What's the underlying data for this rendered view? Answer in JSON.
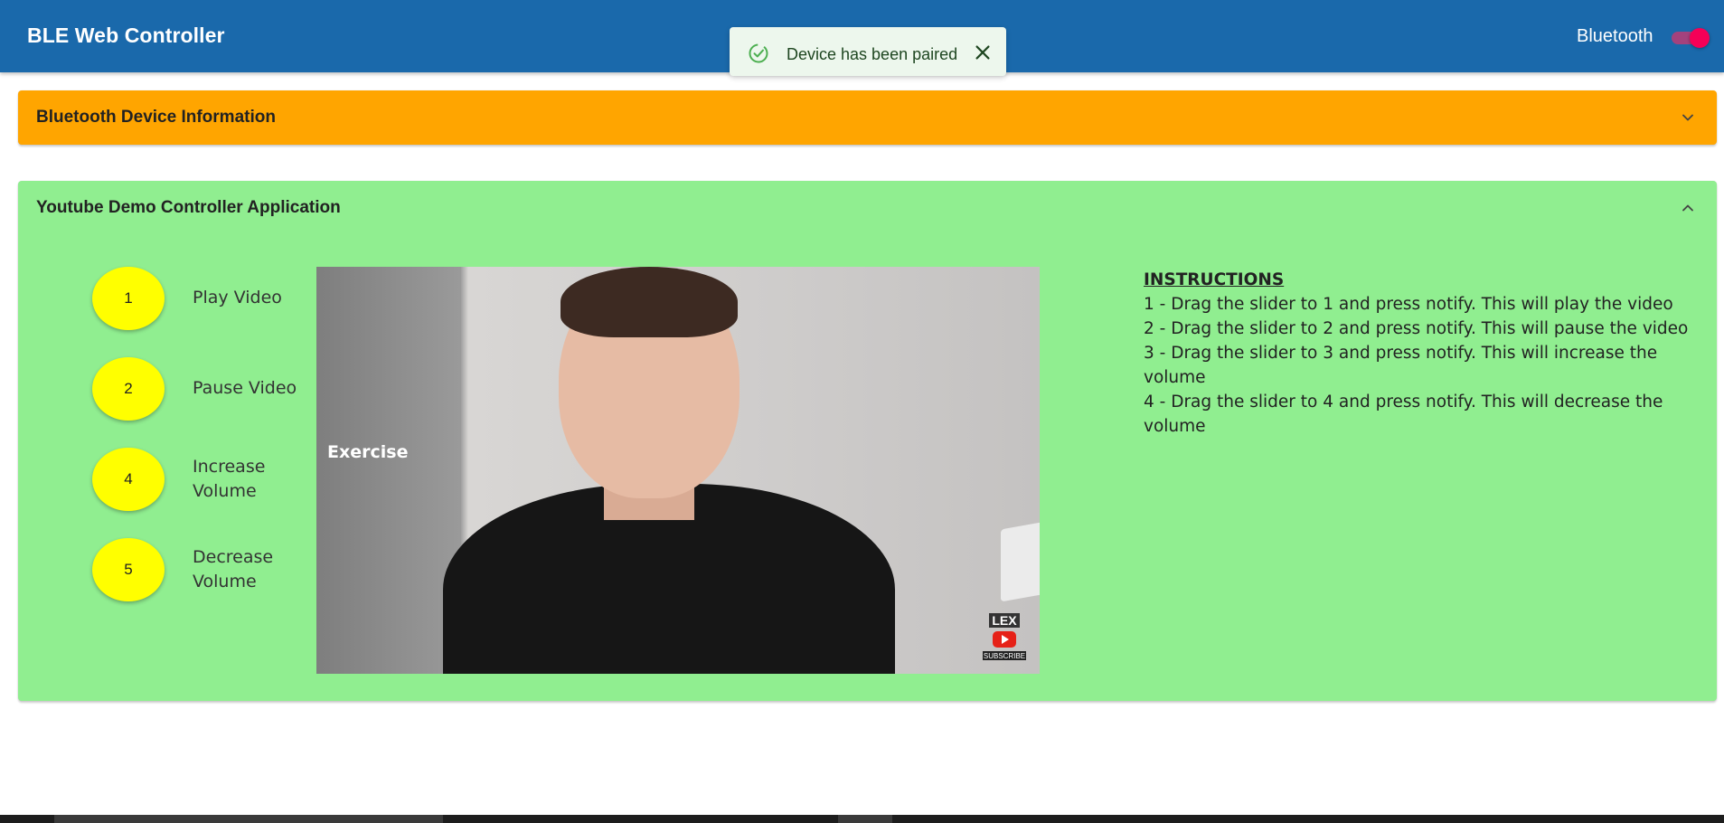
{
  "app": {
    "title": "BLE Web Controller",
    "bluetooth_label": "Bluetooth",
    "bluetooth_enabled": true
  },
  "toast": {
    "message": "Device has been paired",
    "icon": "check-circle-icon",
    "close_icon": "close-icon"
  },
  "panels": {
    "device_info": {
      "title": "Bluetooth Device Information",
      "expanded": false,
      "color": "#ffa500"
    },
    "controller": {
      "title": "Youtube Demo Controller Application",
      "expanded": true,
      "color": "#90ee90"
    }
  },
  "controls": [
    {
      "number": "1",
      "label": "Play Video"
    },
    {
      "number": "2",
      "label": "Pause Video"
    },
    {
      "number": "4",
      "label": "Increase Volume"
    },
    {
      "number": "5",
      "label": "Decrease Volume"
    }
  ],
  "video": {
    "menu_items": [
      "",
      "",
      "",
      "",
      "",
      "",
      "Exercise",
      "",
      "",
      "",
      "",
      "",
      "",
      ""
    ],
    "active_item": "Exercise",
    "badge_text": "LEX",
    "badge_subtext": "SUBSCRIBE"
  },
  "instructions": {
    "title": "INSTRUCTIONS",
    "lines": [
      "1 - Drag the slider to 1 and press notify. This will play the video",
      "2 - Drag the slider to 2 and press notify. This will pause the video",
      "3 - Drag the slider to 3 and press notify. This will increase the volume",
      "4 - Drag the slider to 4 and press notify. This will decrease the volume"
    ]
  },
  "colors": {
    "appbar": "#1a69ab",
    "control_button": "#ffff00",
    "toggle_thumb": "#f50057"
  }
}
